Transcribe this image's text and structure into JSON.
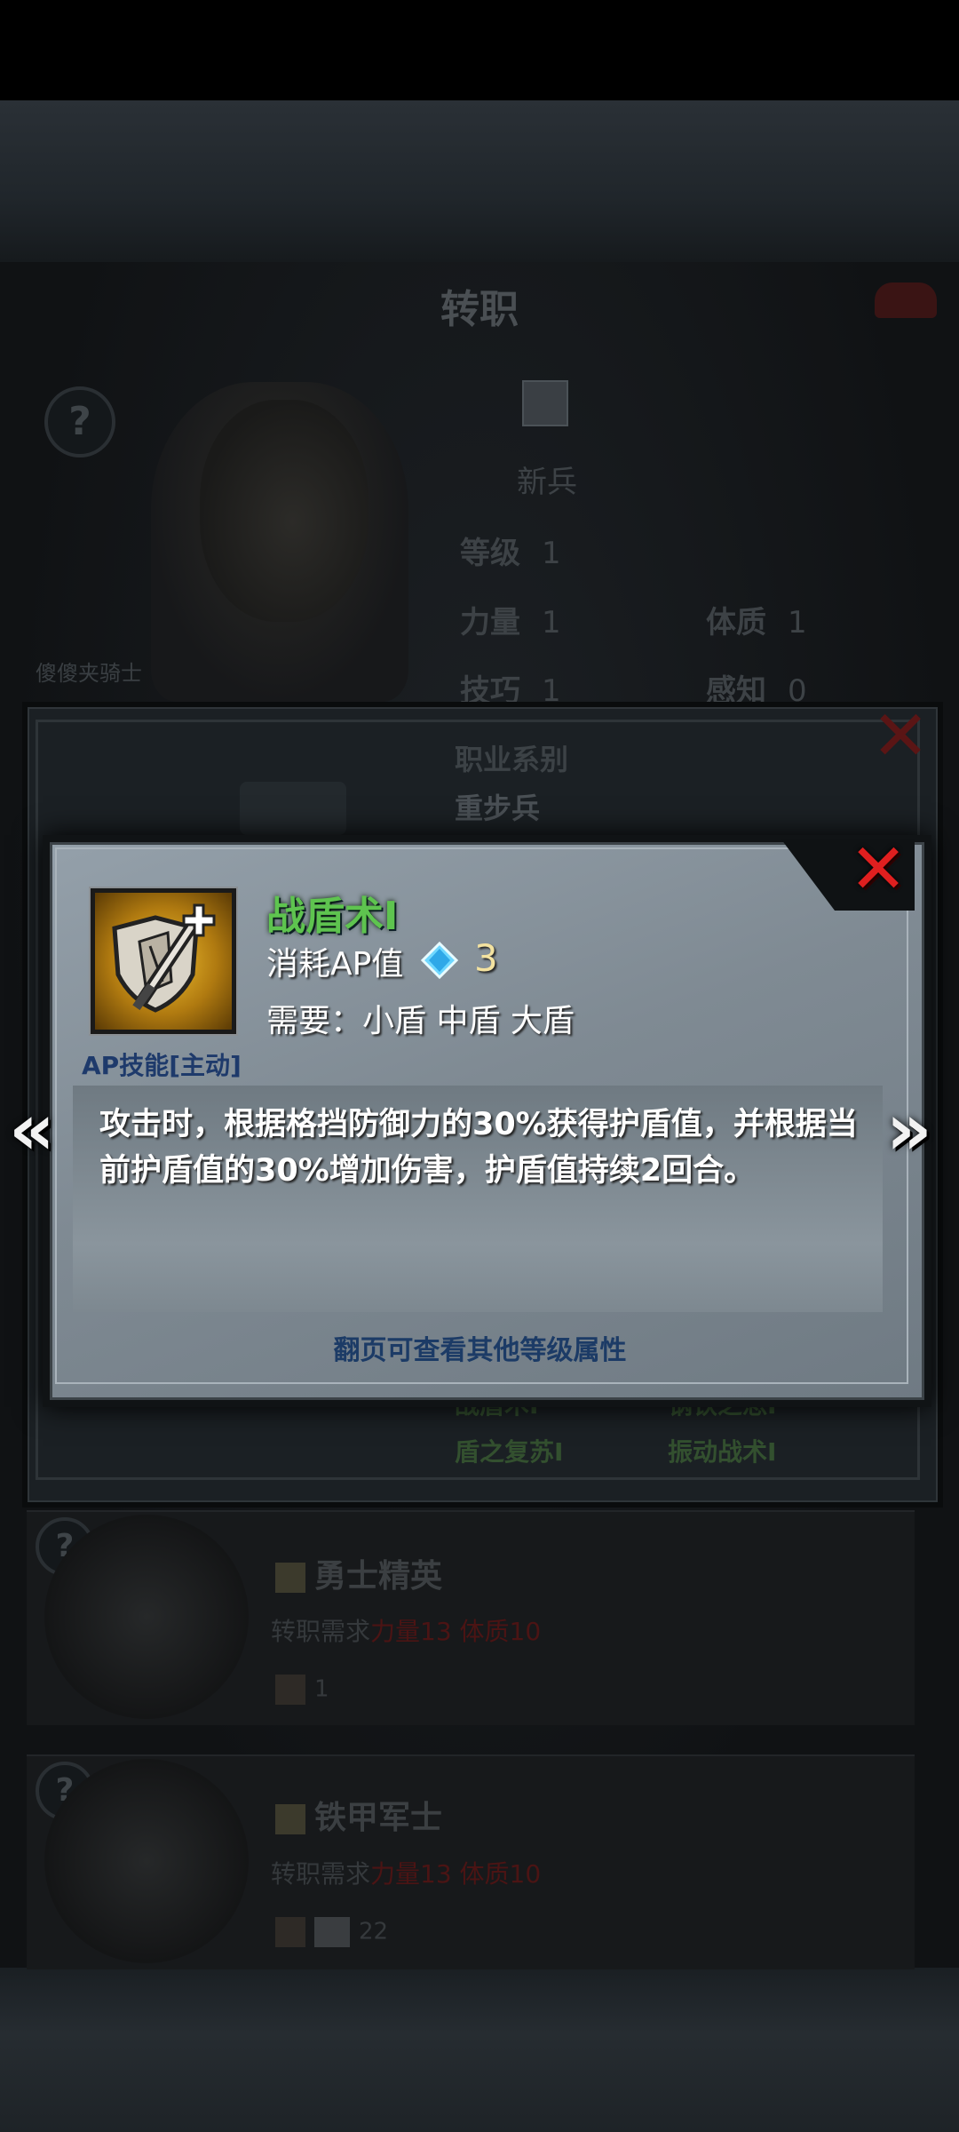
{
  "background": {
    "title": "转职",
    "character": {
      "name": "傻傻夹骑士",
      "job": "新兵",
      "stats": {
        "level_label": "等级",
        "level": "1",
        "str_label": "力量",
        "str": "1",
        "con_label": "体质",
        "con": "1",
        "skill_label": "技巧",
        "skill": "1",
        "per_label": "感知",
        "per": "0"
      }
    },
    "outer_popup": {
      "category_label": "职业系别",
      "category_value": "重步兵",
      "skills": [
        "战盾术I",
        "钢铁之怒I",
        "盾之复苏I",
        "振动战术I"
      ]
    },
    "job_cards": [
      {
        "name": "勇士精英",
        "req_label": "转职需求",
        "req_red": "力量13 体质10",
        "num": "1"
      },
      {
        "name": "铁甲军士",
        "req_label": "转职需求",
        "req_red": "力量13 体质10",
        "num": "22"
      }
    ]
  },
  "skill_popup": {
    "name": "战盾术I",
    "cost_label": "消耗AP值",
    "cost_value": "3",
    "requirement": "需要：小盾 中盾 大盾",
    "type": "AP技能[主动]",
    "description": "攻击时，根据格挡防御力的30%获得护盾值，并根据当前护盾值的30%增加伤害，护盾值持续2回合。",
    "hint": "翻页可查看其他等级属性"
  },
  "colors": {
    "skill_name": "#5ec44f",
    "close": "#e01f1f",
    "hint": "#1c3b66",
    "cost_value": "#f3e2a0"
  },
  "icons": {
    "skill_icon": "shield-sword-icon",
    "gem": "diamond-gem-icon",
    "prev": "double-chevron-left-icon",
    "next": "double-chevron-right-icon",
    "close": "close-x-icon"
  }
}
